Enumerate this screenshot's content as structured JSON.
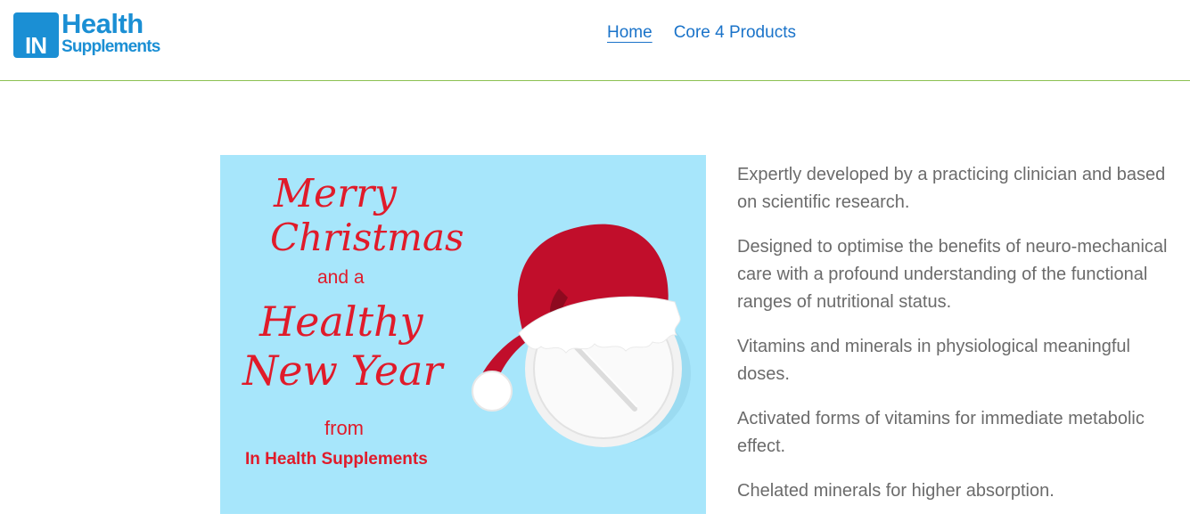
{
  "logo": {
    "badge": "IN",
    "line1": "Health",
    "line2": "Supplements"
  },
  "nav": {
    "items": [
      {
        "label": "Home"
      },
      {
        "label": "Core 4 Products"
      }
    ]
  },
  "hero": {
    "merry": "Merry",
    "christmas": "Christmas",
    "and_a": "and a",
    "healthy": "Healthy",
    "new_year": "New Year",
    "from": "from",
    "company": "In Health Supplements"
  },
  "features": [
    "Expertly developed by a practicing clinician and based on scientific research.",
    "Designed to optimise the benefits of neuro-mechanical care with a profound understanding of the functional ranges of nutritional status.",
    "Vitamins and minerals in physiological meaningful doses.",
    "Activated forms of vitamins for immediate metabolic effect.",
    "Chelated minerals for higher absorption."
  ],
  "colors": {
    "brand_blue": "#1b8fd4",
    "nav_link": "#1a73c9",
    "header_rule": "#8cc152",
    "hero_bg": "#a7e6fb",
    "hero_red": "#e01b2a",
    "body_text": "#6b6b6b"
  }
}
